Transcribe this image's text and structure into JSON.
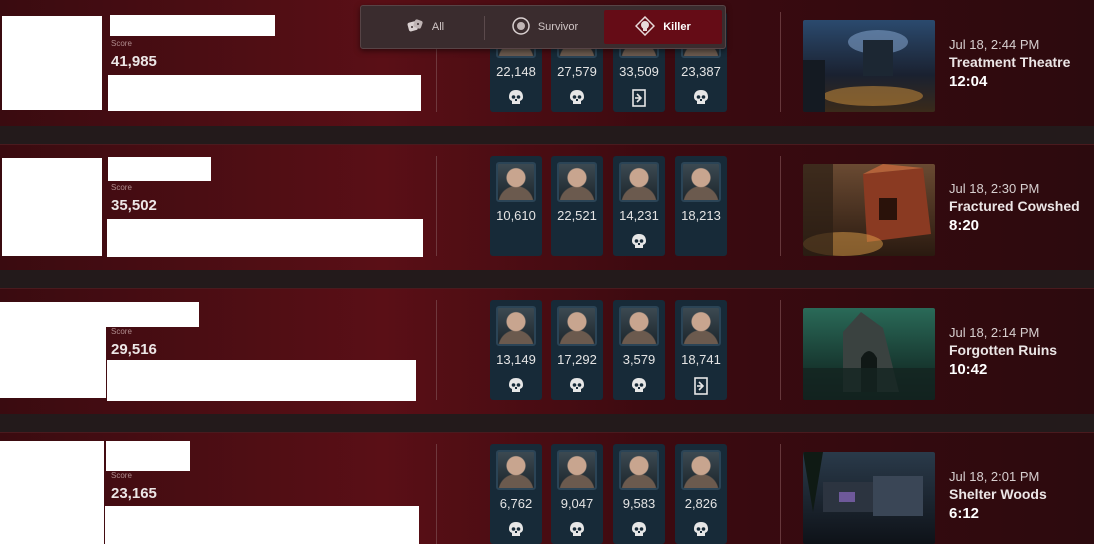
{
  "filter": {
    "tabs": [
      {
        "label": "All",
        "icon": "dice-icon"
      },
      {
        "label": "Survivor",
        "icon": "survivor-icon"
      },
      {
        "label": "Killer",
        "icon": "killer-icon"
      }
    ],
    "active": "Killer"
  },
  "score_label": "Score",
  "matches": [
    {
      "score": "41,985",
      "survivors": [
        {
          "score": "22,148",
          "status": "sacrificed-skull-icon"
        },
        {
          "score": "27,579",
          "status": "sacrificed-skull-icon"
        },
        {
          "score": "33,509",
          "status": "escaped-exit-icon"
        },
        {
          "score": "23,387",
          "status": "sacrificed-skull-icon"
        }
      ],
      "date": "Jul 18, 2:44 PM",
      "map": "Treatment Theatre",
      "duration": "12:04"
    },
    {
      "score": "35,502",
      "survivors": [
        {
          "score": "10,610",
          "status": "none"
        },
        {
          "score": "22,521",
          "status": "none"
        },
        {
          "score": "14,231",
          "status": "sacrificed-skull-icon"
        },
        {
          "score": "18,213",
          "status": "none"
        }
      ],
      "date": "Jul 18, 2:30 PM",
      "map": "Fractured Cowshed",
      "duration": "8:20"
    },
    {
      "score": "29,516",
      "survivors": [
        {
          "score": "13,149",
          "status": "sacrificed-skull-icon"
        },
        {
          "score": "17,292",
          "status": "sacrificed-skull-icon"
        },
        {
          "score": "3,579",
          "status": "sacrificed-skull-icon"
        },
        {
          "score": "18,741",
          "status": "escaped-exit-icon"
        }
      ],
      "date": "Jul 18, 2:14 PM",
      "map": "Forgotten Ruins",
      "duration": "10:42"
    },
    {
      "score": "23,165",
      "survivors": [
        {
          "score": "6,762",
          "status": "sacrificed-skull-icon"
        },
        {
          "score": "9,047",
          "status": "sacrificed-skull-icon"
        },
        {
          "score": "9,583",
          "status": "sacrificed-skull-icon"
        },
        {
          "score": "2,826",
          "status": "sacrificed-skull-icon"
        }
      ],
      "date": "Jul 18, 2:01 PM",
      "map": "Shelter Woods",
      "duration": "6:12"
    }
  ],
  "colors": {
    "accent": "#650c16",
    "row_bg": "#5a0f16",
    "card_bg": "#172a38"
  }
}
